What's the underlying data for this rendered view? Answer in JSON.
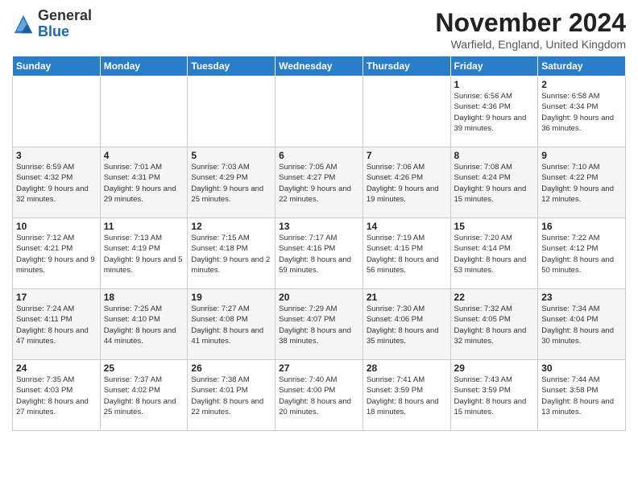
{
  "header": {
    "logo": {
      "general": "General",
      "blue": "Blue"
    },
    "title": "November 2024",
    "location": "Warfield, England, United Kingdom"
  },
  "days_of_week": [
    "Sunday",
    "Monday",
    "Tuesday",
    "Wednesday",
    "Thursday",
    "Friday",
    "Saturday"
  ],
  "weeks": [
    [
      {
        "day": "",
        "info": ""
      },
      {
        "day": "",
        "info": ""
      },
      {
        "day": "",
        "info": ""
      },
      {
        "day": "",
        "info": ""
      },
      {
        "day": "",
        "info": ""
      },
      {
        "day": "1",
        "info": "Sunrise: 6:56 AM\nSunset: 4:36 PM\nDaylight: 9 hours and 39 minutes."
      },
      {
        "day": "2",
        "info": "Sunrise: 6:58 AM\nSunset: 4:34 PM\nDaylight: 9 hours and 36 minutes."
      }
    ],
    [
      {
        "day": "3",
        "info": "Sunrise: 6:59 AM\nSunset: 4:32 PM\nDaylight: 9 hours and 32 minutes."
      },
      {
        "day": "4",
        "info": "Sunrise: 7:01 AM\nSunset: 4:31 PM\nDaylight: 9 hours and 29 minutes."
      },
      {
        "day": "5",
        "info": "Sunrise: 7:03 AM\nSunset: 4:29 PM\nDaylight: 9 hours and 25 minutes."
      },
      {
        "day": "6",
        "info": "Sunrise: 7:05 AM\nSunset: 4:27 PM\nDaylight: 9 hours and 22 minutes."
      },
      {
        "day": "7",
        "info": "Sunrise: 7:06 AM\nSunset: 4:26 PM\nDaylight: 9 hours and 19 minutes."
      },
      {
        "day": "8",
        "info": "Sunrise: 7:08 AM\nSunset: 4:24 PM\nDaylight: 9 hours and 15 minutes."
      },
      {
        "day": "9",
        "info": "Sunrise: 7:10 AM\nSunset: 4:22 PM\nDaylight: 9 hours and 12 minutes."
      }
    ],
    [
      {
        "day": "10",
        "info": "Sunrise: 7:12 AM\nSunset: 4:21 PM\nDaylight: 9 hours and 9 minutes."
      },
      {
        "day": "11",
        "info": "Sunrise: 7:13 AM\nSunset: 4:19 PM\nDaylight: 9 hours and 5 minutes."
      },
      {
        "day": "12",
        "info": "Sunrise: 7:15 AM\nSunset: 4:18 PM\nDaylight: 9 hours and 2 minutes."
      },
      {
        "day": "13",
        "info": "Sunrise: 7:17 AM\nSunset: 4:16 PM\nDaylight: 8 hours and 59 minutes."
      },
      {
        "day": "14",
        "info": "Sunrise: 7:19 AM\nSunset: 4:15 PM\nDaylight: 8 hours and 56 minutes."
      },
      {
        "day": "15",
        "info": "Sunrise: 7:20 AM\nSunset: 4:14 PM\nDaylight: 8 hours and 53 minutes."
      },
      {
        "day": "16",
        "info": "Sunrise: 7:22 AM\nSunset: 4:12 PM\nDaylight: 8 hours and 50 minutes."
      }
    ],
    [
      {
        "day": "17",
        "info": "Sunrise: 7:24 AM\nSunset: 4:11 PM\nDaylight: 8 hours and 47 minutes."
      },
      {
        "day": "18",
        "info": "Sunrise: 7:25 AM\nSunset: 4:10 PM\nDaylight: 8 hours and 44 minutes."
      },
      {
        "day": "19",
        "info": "Sunrise: 7:27 AM\nSunset: 4:08 PM\nDaylight: 8 hours and 41 minutes."
      },
      {
        "day": "20",
        "info": "Sunrise: 7:29 AM\nSunset: 4:07 PM\nDaylight: 8 hours and 38 minutes."
      },
      {
        "day": "21",
        "info": "Sunrise: 7:30 AM\nSunset: 4:06 PM\nDaylight: 8 hours and 35 minutes."
      },
      {
        "day": "22",
        "info": "Sunrise: 7:32 AM\nSunset: 4:05 PM\nDaylight: 8 hours and 32 minutes."
      },
      {
        "day": "23",
        "info": "Sunrise: 7:34 AM\nSunset: 4:04 PM\nDaylight: 8 hours and 30 minutes."
      }
    ],
    [
      {
        "day": "24",
        "info": "Sunrise: 7:35 AM\nSunset: 4:03 PM\nDaylight: 8 hours and 27 minutes."
      },
      {
        "day": "25",
        "info": "Sunrise: 7:37 AM\nSunset: 4:02 PM\nDaylight: 8 hours and 25 minutes."
      },
      {
        "day": "26",
        "info": "Sunrise: 7:38 AM\nSunset: 4:01 PM\nDaylight: 8 hours and 22 minutes."
      },
      {
        "day": "27",
        "info": "Sunrise: 7:40 AM\nSunset: 4:00 PM\nDaylight: 8 hours and 20 minutes."
      },
      {
        "day": "28",
        "info": "Sunrise: 7:41 AM\nSunset: 3:59 PM\nDaylight: 8 hours and 18 minutes."
      },
      {
        "day": "29",
        "info": "Sunrise: 7:43 AM\nSunset: 3:59 PM\nDaylight: 8 hours and 15 minutes."
      },
      {
        "day": "30",
        "info": "Sunrise: 7:44 AM\nSunset: 3:58 PM\nDaylight: 8 hours and 13 minutes."
      }
    ]
  ]
}
